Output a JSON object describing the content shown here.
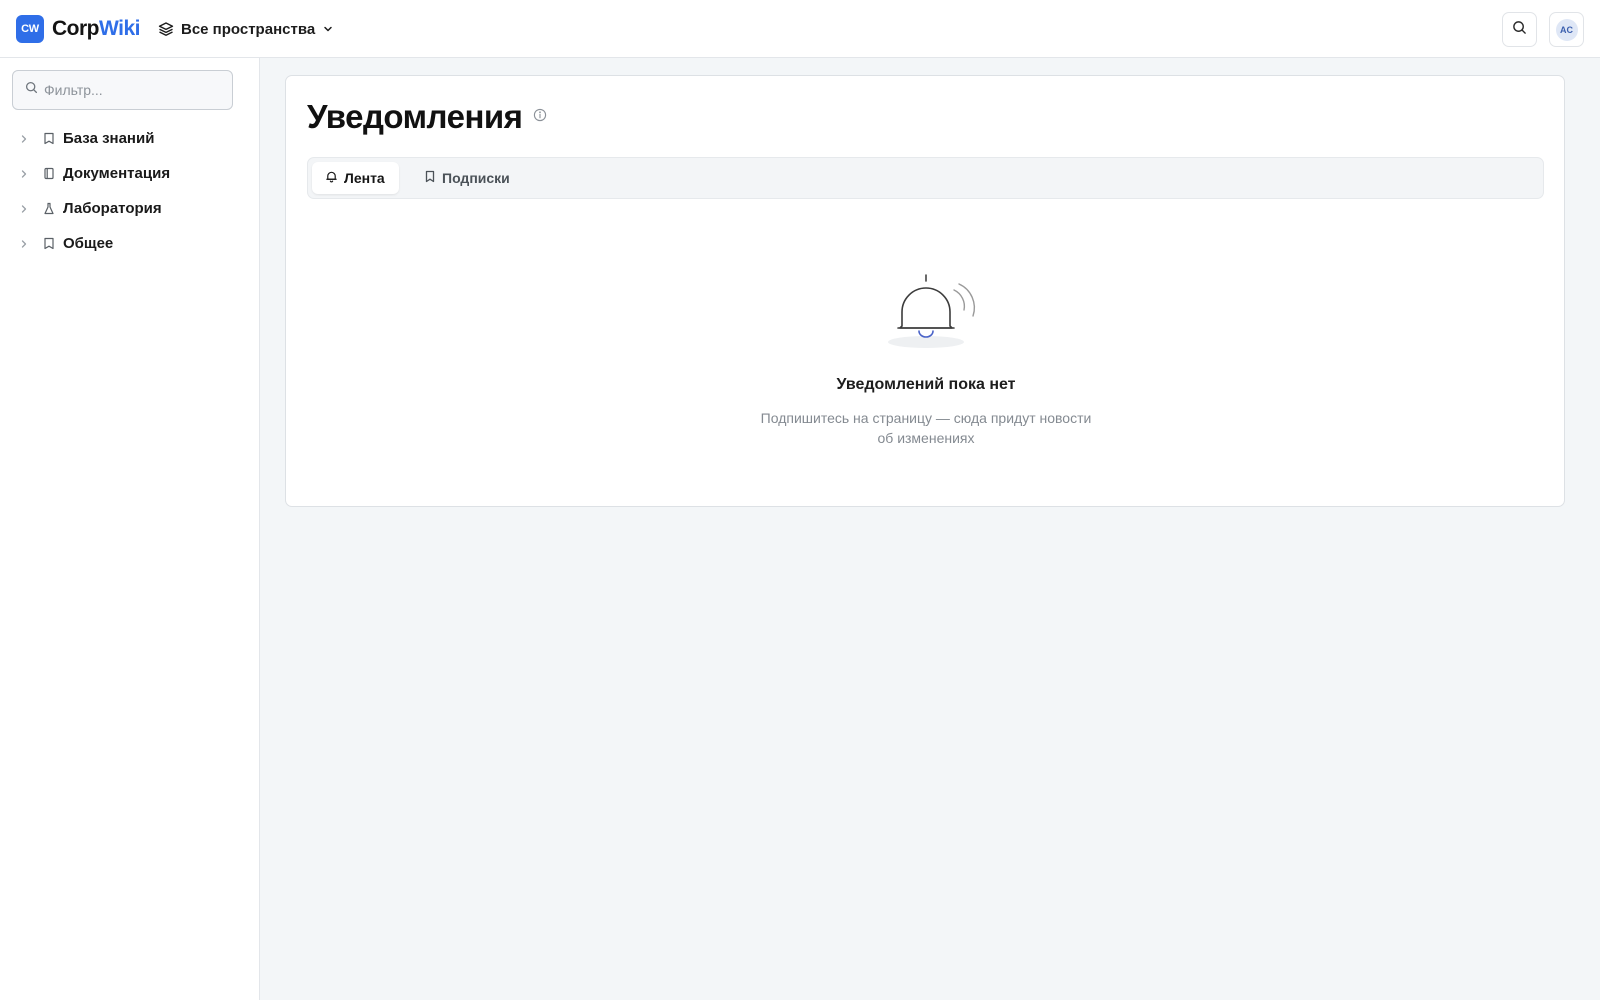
{
  "header": {
    "logo_badge": "CW",
    "logo_part1": "Corp",
    "logo_part2": "Wiki",
    "space_switcher": "Все пространства",
    "avatar_initials": "AC"
  },
  "sidebar": {
    "filter_placeholder": "Фильтр...",
    "items": [
      {
        "label": "База знаний",
        "icon": "book-icon"
      },
      {
        "label": "Документация",
        "icon": "notebook-icon"
      },
      {
        "label": "Лаборатория",
        "icon": "flask-icon"
      },
      {
        "label": "Общее",
        "icon": "book-icon"
      }
    ]
  },
  "main": {
    "title": "Уведомления",
    "tabs": [
      {
        "label": "Лента",
        "icon": "bell-icon",
        "active": true
      },
      {
        "label": "Подписки",
        "icon": "bookmark-icon",
        "active": false
      }
    ],
    "empty_state": {
      "title": "Уведомлений пока нет",
      "subtitle": "Подпишитесь на страницу — сюда придут новости об изменениях"
    }
  },
  "colors": {
    "accent": "#2f6ee8",
    "page_bg": "#f3f6f8",
    "muted_text": "#848a91"
  }
}
